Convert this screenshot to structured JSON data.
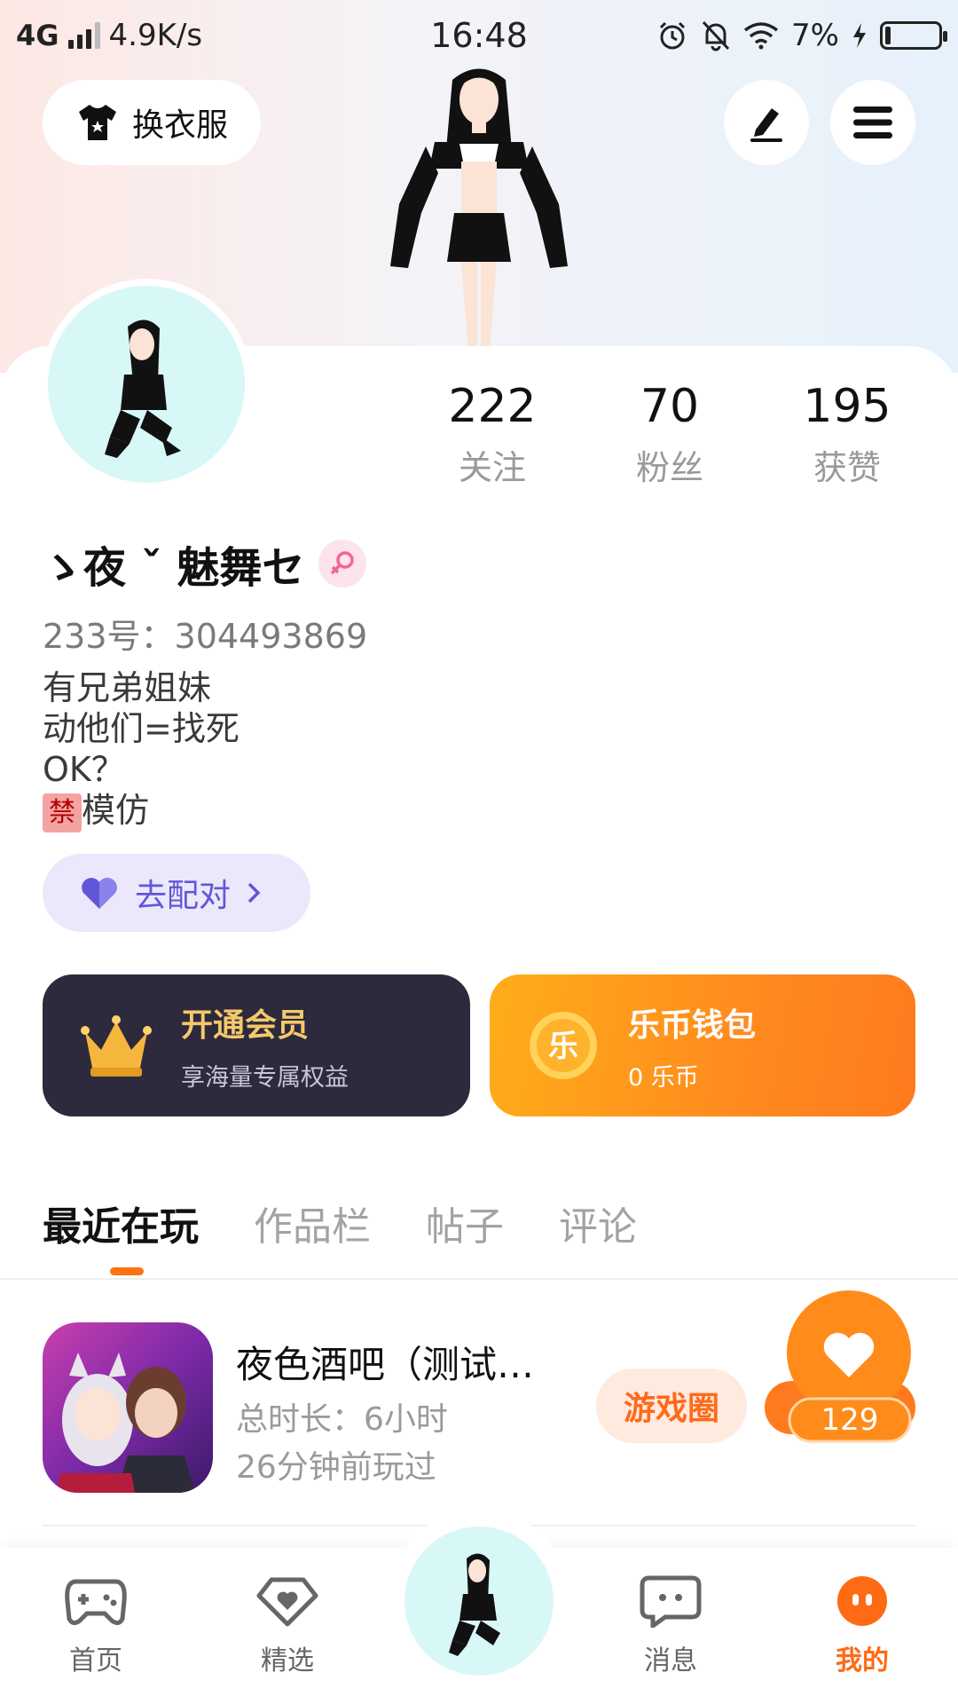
{
  "status_bar": {
    "network": "4G",
    "speed": "4.9K/s",
    "time": "16:48",
    "battery": "7%"
  },
  "header": {
    "outfit_label": "换衣服"
  },
  "profile": {
    "nickname": "ゝ夜 ˇ 魅舞セ",
    "uid": "233号：304493869",
    "bio_lines": [
      "有兄弟姐妹",
      "动他们=找死",
      "OK？",
      "模仿"
    ],
    "ban_char": "禁",
    "pair_label": "去配对"
  },
  "stats": [
    {
      "value": "222",
      "label": "关注"
    },
    {
      "value": "70",
      "label": "粉丝"
    },
    {
      "value": "195",
      "label": "获赞"
    }
  ],
  "promos": {
    "vip_title": "开通会员",
    "vip_sub": "享海量专属权益",
    "wallet_title": "乐币钱包",
    "wallet_sub": "0 乐币",
    "wallet_icon_char": "乐"
  },
  "tabs": [
    "最近在玩",
    "作品栏",
    "帖子",
    "评论"
  ],
  "recent_game": {
    "title": "夜色酒吧（测试…",
    "duration": "总时长：6小时",
    "last_played": "26分钟前玩过",
    "circle_label": "游戏圈",
    "like_count": "129"
  },
  "bottom_nav": [
    {
      "label": "首页"
    },
    {
      "label": "精选"
    },
    {
      "label": "消息"
    },
    {
      "label": "我的"
    }
  ],
  "colors": {
    "accent": "#ff6a14",
    "vip_bg": "#2c2a3c",
    "vip_gold": "#f5c86a",
    "pair_purple": "#6156d8"
  }
}
